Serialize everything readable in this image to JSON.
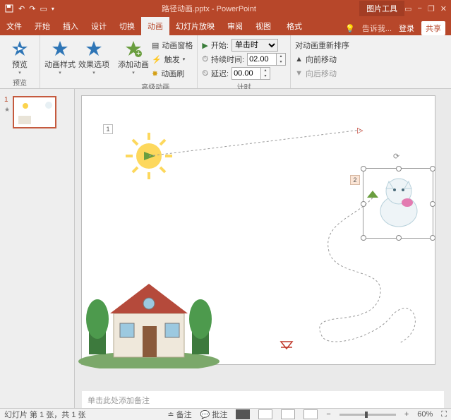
{
  "titlebar": {
    "doc": "路径动画.pptx - PowerPoint",
    "contextual": "图片工具"
  },
  "tabs": [
    "文件",
    "开始",
    "插入",
    "设计",
    "切换",
    "动画",
    "幻灯片放映",
    "审阅",
    "视图",
    "格式"
  ],
  "menu_right": {
    "tell_me": "告诉我...",
    "signin": "登录",
    "share": "共享"
  },
  "ribbon": {
    "preview": {
      "btn": "预览",
      "group": "预览"
    },
    "anim": {
      "style": "动画样式",
      "effect": "效果选项"
    },
    "add": {
      "btn": "添加动画"
    },
    "advanced": {
      "pane": "动画窗格",
      "trigger": "触发",
      "painter": "动画刷",
      "group": "高级动画"
    },
    "timing": {
      "start_lbl": "开始:",
      "start_val": "单击时",
      "duration_lbl": "持续时间:",
      "duration_val": "02.00",
      "delay_lbl": "延迟:",
      "delay_val": "00.00",
      "group": "计时"
    },
    "reorder": {
      "title": "对动画重新排序",
      "earlier": "向前移动",
      "later": "向后移动"
    }
  },
  "slide": {
    "tag1": "1",
    "tag2": "2"
  },
  "notes": {
    "placeholder": "单击此处添加备注"
  },
  "status": {
    "slide_info": "幻灯片 第 1 张，共 1 张",
    "lang": "",
    "notes_btn": "备注",
    "comments_btn": "批注",
    "zoom": "60%"
  },
  "thumb": {
    "num": "1"
  }
}
